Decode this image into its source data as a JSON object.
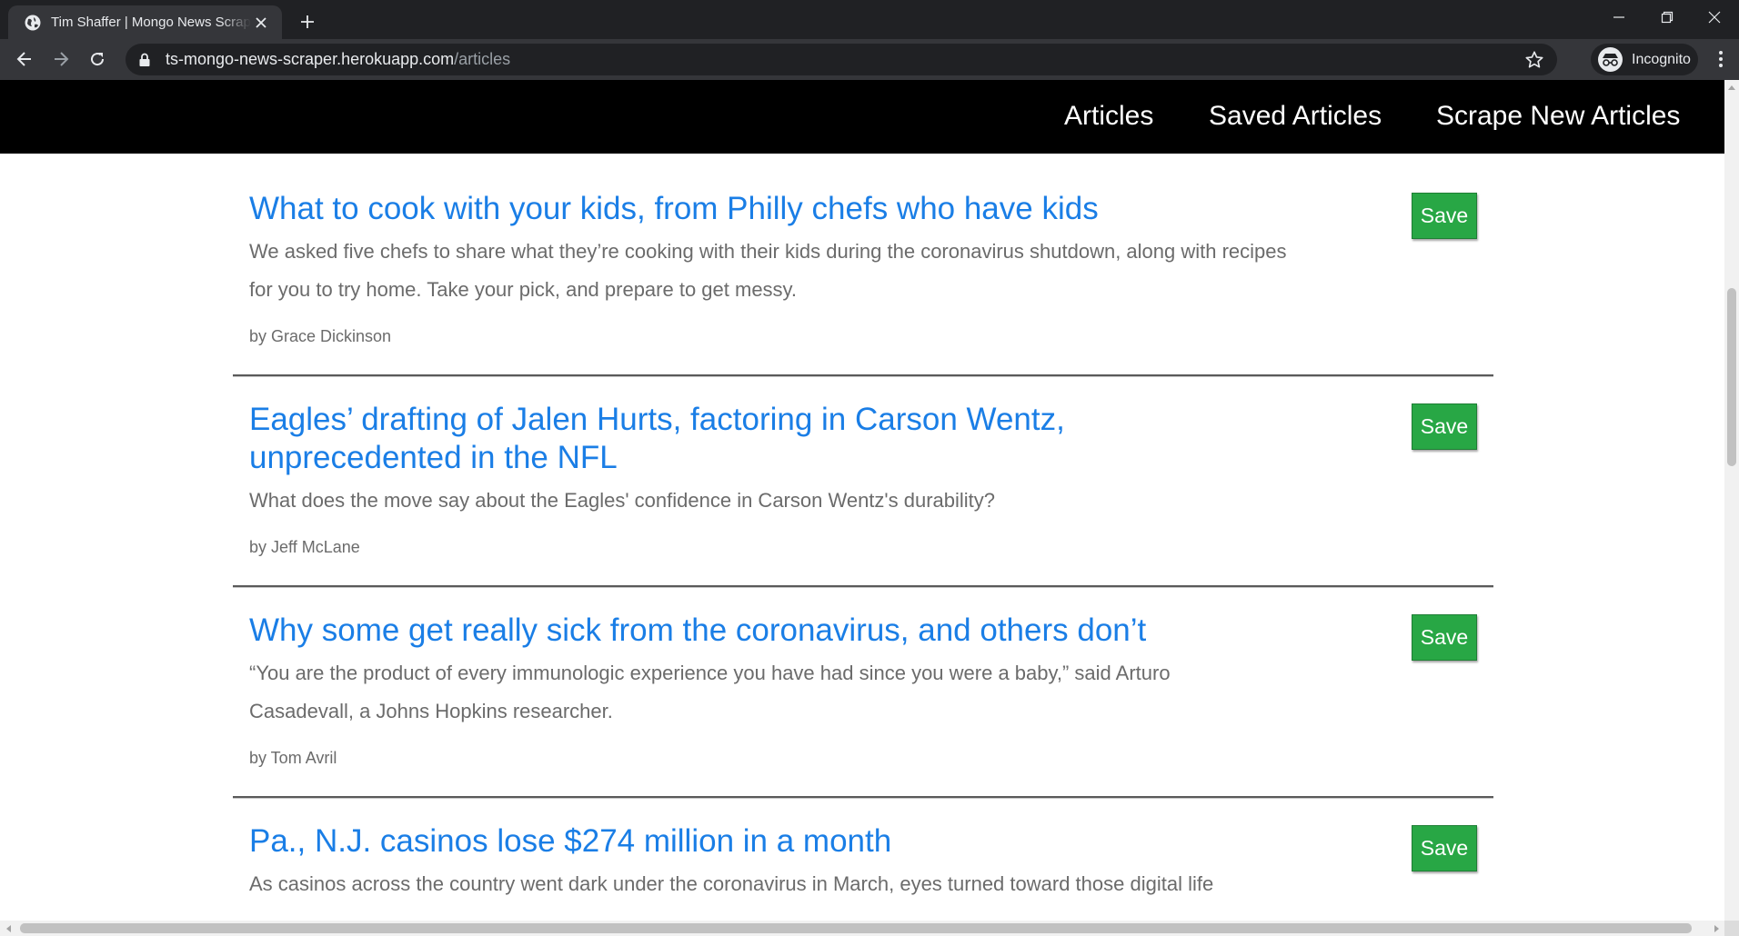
{
  "browser": {
    "tab_title": "Tim Shaffer | Mongo News Scraper",
    "url_host": "ts-mongo-news-scraper.herokuapp.com",
    "url_path": "/articles",
    "profile_label": "Incognito"
  },
  "nav": {
    "links": [
      "Articles",
      "Saved Articles",
      "Scrape New Articles"
    ]
  },
  "articles": [
    {
      "title": "What to cook with your kids, from Philly chefs who have kids",
      "summary": "We asked five chefs to share what they’re cooking with their kids during the coronavirus shutdown, along with recipes for you to try home. Take your pick, and prepare to get messy.",
      "author": "by Grace Dickinson",
      "save_label": "Save"
    },
    {
      "title": "Eagles’ drafting of Jalen Hurts, factoring in Carson Wentz, unprecedented in the NFL",
      "summary": "What does the move say about the Eagles' confidence in Carson Wentz's durability?",
      "author": "by Jeff McLane",
      "save_label": "Save"
    },
    {
      "title": "Why some get really sick from the coronavirus, and others don’t",
      "summary": "“You are the product of every immunologic experience you have had since you were a baby,” said Arturo Casadevall, a Johns Hopkins researcher.",
      "author": "by Tom Avril",
      "save_label": "Save"
    },
    {
      "title": "Pa., N.J. casinos lose $274 million in a month",
      "summary": "As casinos across the country went dark under the coronavirus in March, eyes turned toward those digital life",
      "author": "",
      "save_label": "Save"
    }
  ],
  "colors": {
    "title_link": "#1a7ee6",
    "save_button": "#28a745",
    "nav_background": "#000000",
    "body_text": "#6b6b6b"
  }
}
